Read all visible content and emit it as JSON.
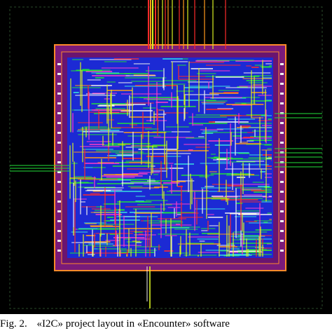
{
  "caption": {
    "label": "Fig. 2.",
    "text": "«I2C» project layout in «Encounter» software"
  },
  "colors": {
    "background": "#000000",
    "core": "#1f2bd8",
    "ring": "#8a1a8a",
    "pad_ring_outline": "#ff8a2a",
    "metal_green": "#22e03a",
    "metal_yellow": "#d8f020",
    "metal_red": "#ff2a2a",
    "metal_magenta": "#ff3cc8",
    "metal_cyan": "#38e0e0",
    "metal_white": "#f0f0f0",
    "metal_orange": "#ff9a1a"
  },
  "icons": [
    "routing-layout-image"
  ]
}
